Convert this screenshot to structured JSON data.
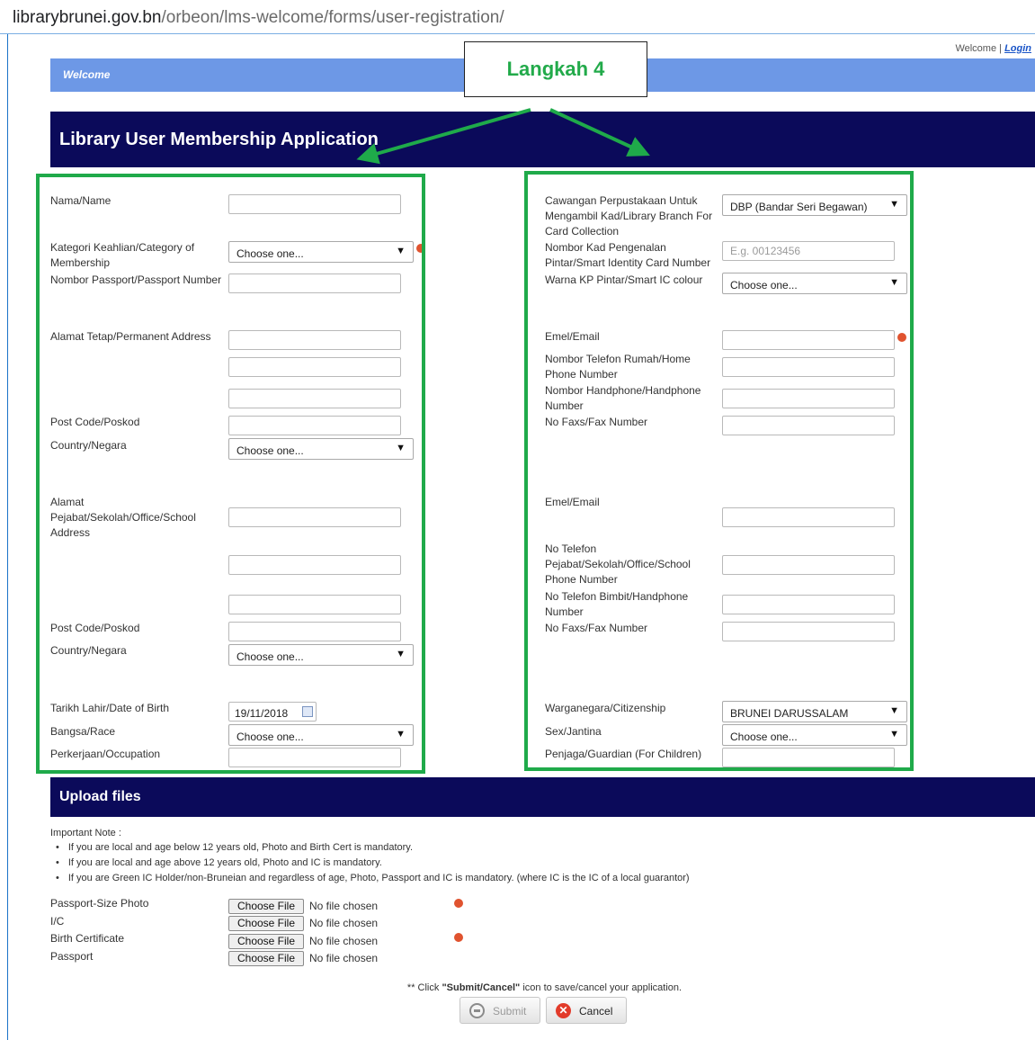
{
  "browser": {
    "url_host": "librarybrunei.gov.bn",
    "url_path": "/orbeon/lms-welcome/forms/user-registration/"
  },
  "header": {
    "welcome_text": "Welcome |",
    "login_link": "Login",
    "welcome_bar": "Welcome",
    "title": "Library User Membership Application"
  },
  "annotation": {
    "callout": "Langkah 4",
    "box_color": "#1faa4a"
  },
  "left": {
    "name_label": "Nama/Name",
    "category_label": "Kategori Keahlian/Category of Membership",
    "category_value": "Choose one...",
    "passport_label": "Nombor Passport/Passport Number",
    "address_label": "Alamat Tetap/Permanent Address",
    "postcode_label": "Post Code/Poskod",
    "country_label": "Country/Negara",
    "country_value": "Choose one...",
    "office_address_label": "Alamat Pejabat/Sekolah/Office/School Address",
    "office_postcode_label": "Post Code/Poskod",
    "office_country_label": "Country/Negara",
    "office_country_value": "Choose one...",
    "dob_label": "Tarikh Lahir/Date of Birth",
    "dob_value": "19/11/2018",
    "race_label": "Bangsa/Race",
    "race_value": "Choose one...",
    "occupation_label": "Perkerjaan/Occupation"
  },
  "right": {
    "branch_label": "Cawangan Perpustakaan Untuk Mengambil Kad/Library Branch For Card Collection",
    "branch_value": "DBP (Bandar Seri Begawan)",
    "ic_label": "Nombor Kad Pengenalan Pintar/Smart Identity Card Number",
    "ic_placeholder": "E.g. 00123456",
    "ic_colour_label": "Warna KP Pintar/Smart IC colour",
    "ic_colour_value": "Choose one...",
    "email_label": "Emel/Email",
    "home_phone_label": "Nombor Telefon Rumah/Home Phone Number",
    "handphone_label": "Nombor Handphone/Handphone Number",
    "fax_label": "No Faxs/Fax Number",
    "office_email_label": "Emel/Email",
    "office_phone_label": "No Telefon Pejabat/Sekolah/Office/School Phone Number",
    "office_handphone_label": "No Telefon Bimbit/Handphone Number",
    "office_fax_label": "No Faxs/Fax Number",
    "citizenship_label": "Warganegara/Citizenship",
    "citizenship_value": "BRUNEI DARUSSALAM",
    "sex_label": "Sex/Jantina",
    "sex_value": "Choose one...",
    "guardian_label": "Penjaga/Guardian (For Children)"
  },
  "upload": {
    "title": "Upload files",
    "note_title": "Important Note :",
    "notes": [
      "If you are local and age below 12 years old, Photo and Birth Cert is mandatory.",
      "If you are local and age above 12 years old, Photo and IC is mandatory.",
      "If you are Green IC Holder/non-Bruneian and regardless of age, Photo, Passport and IC is mandatory. (where IC is the IC of a local guarantor)"
    ],
    "files": [
      {
        "label": "Passport-Size Photo",
        "button": "Choose File",
        "status": "No file chosen"
      },
      {
        "label": "I/C",
        "button": "Choose File",
        "status": "No file chosen"
      },
      {
        "label": "Birth Certificate",
        "button": "Choose File",
        "status": "No file chosen"
      },
      {
        "label": "Passport",
        "button": "Choose File",
        "status": "No file chosen"
      }
    ],
    "instruction_prefix": "** Click ",
    "instruction_bold": "\"Submit/Cancel\"",
    "instruction_suffix": " icon to save/cancel your application.",
    "submit_label": "Submit",
    "cancel_label": "Cancel"
  }
}
